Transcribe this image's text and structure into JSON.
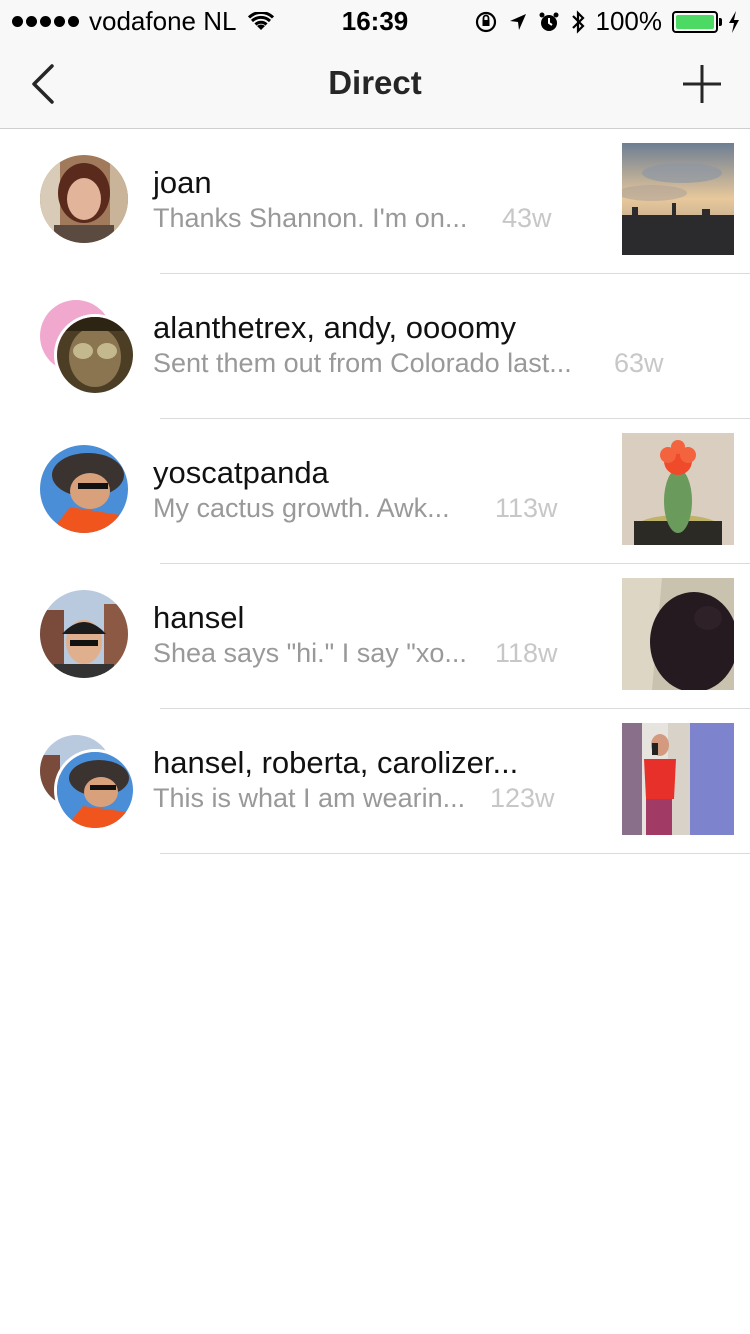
{
  "status_bar": {
    "carrier": "vodafone NL",
    "time": "16:39",
    "battery": "100%",
    "battery_color": "#4cd964"
  },
  "header": {
    "title": "Direct",
    "back_icon": "chevron-left-icon",
    "new_icon": "plus-icon"
  },
  "threads": [
    {
      "name": "joan",
      "preview": "Thanks Shannon. I'm on...",
      "age": "43w"
    },
    {
      "name": "alanthetrex, andy, oooomy",
      "preview": "Sent them out from Colorado last...",
      "age": "63w"
    },
    {
      "name": "yoscatpanda",
      "preview": "My cactus growth. Awk...",
      "age": "113w"
    },
    {
      "name": "hansel",
      "preview": "Shea says \"hi.\" I say \"xo...",
      "age": "118w"
    },
    {
      "name": "hansel, roberta, carolizer...",
      "preview": "This is what I am wearin...",
      "age": "123w"
    }
  ]
}
